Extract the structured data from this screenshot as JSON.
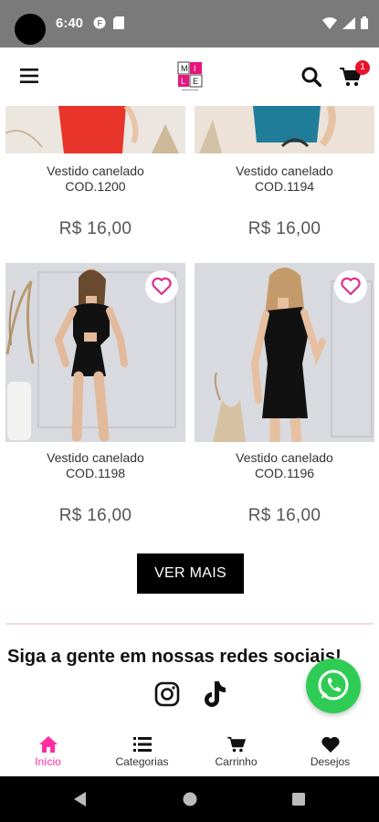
{
  "status_bar": {
    "time": "6:40"
  },
  "header": {
    "cart_count": "1",
    "logo_alt": "M I L E"
  },
  "products": [
    {
      "name": "Vestido canelado",
      "code": "COD.1200",
      "price": "R$  16,00",
      "dress_color": "#e8342a",
      "bg": "#e4dcd4"
    },
    {
      "name": "Vestido canelado",
      "code": "COD.1194",
      "price": "R$  16,00",
      "dress_color": "#1f7d9a",
      "bg": "#e9ddd2"
    },
    {
      "name": "Vestido canelado",
      "code": "COD.1198",
      "price": "R$  16,00",
      "dress_color": "#111111",
      "bg": "#d9dadf"
    },
    {
      "name": "Vestido canelado",
      "code": "COD.1196",
      "price": "R$  16,00",
      "dress_color": "#111111",
      "bg": "#d8dadf"
    }
  ],
  "buttons": {
    "ver_mais": "VER MAIS"
  },
  "social": {
    "title": "Siga a gente em nossas redes sociais!"
  },
  "bottom_nav": {
    "items": [
      {
        "label": "Início",
        "icon": "home-icon"
      },
      {
        "label": "Categorias",
        "icon": "list-icon"
      },
      {
        "label": "Carrinho",
        "icon": "cart-icon"
      },
      {
        "label": "Desejos",
        "icon": "heart-icon"
      }
    ]
  },
  "colors": {
    "accent": "#ff2fa0",
    "whatsapp": "#2ecc55",
    "badge": "#e8122d"
  }
}
